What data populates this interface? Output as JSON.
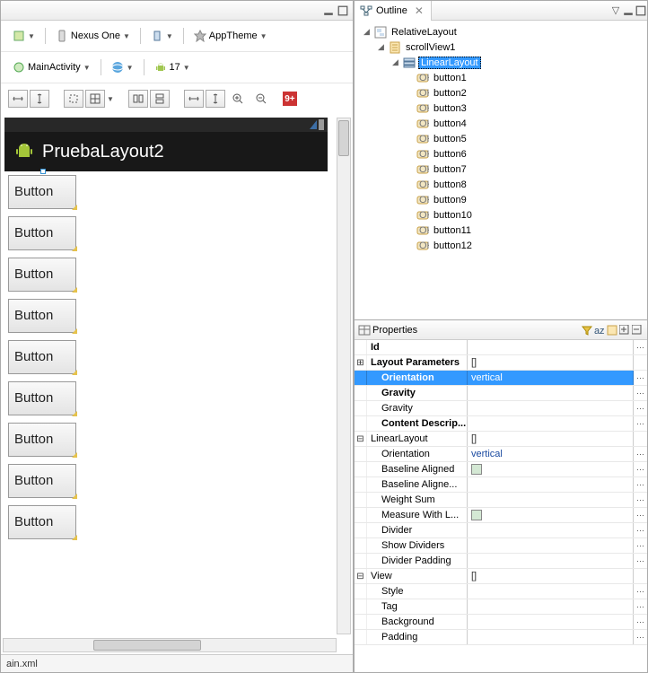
{
  "toolbar": {
    "device": "Nexus One",
    "theme": "AppTheme",
    "activity": "MainActivity",
    "api": "17"
  },
  "preview": {
    "title": "PruebaLayout2",
    "button_label": "Button",
    "button_count": 9
  },
  "editor_tab": "ain.xml",
  "outline": {
    "tab": "Outline",
    "root": "RelativeLayout",
    "scroll": "scrollView1",
    "linear": "LinearLayout",
    "buttons": [
      "button1",
      "button2",
      "button3",
      "button4",
      "button5",
      "button6",
      "button7",
      "button8",
      "button9",
      "button10",
      "button11",
      "button12"
    ]
  },
  "properties": {
    "title": "Properties",
    "rows": {
      "id": "Id",
      "layout_params": "Layout Parameters",
      "layout_params_val": "[]",
      "orientation": "Orientation",
      "orientation_val": "vertical",
      "gravity_b": "Gravity",
      "gravity": "Gravity",
      "content_desc": "Content Descrip...",
      "linear": "LinearLayout",
      "linear_val": "[]",
      "orientation2": "Orientation",
      "orientation2_val": "vertical",
      "baseline": "Baseline Aligned",
      "baseline_idx": "Baseline Aligne...",
      "weight": "Weight Sum",
      "measure": "Measure With L...",
      "divider": "Divider",
      "show_div": "Show Dividers",
      "div_pad": "Divider Padding",
      "view": "View",
      "view_val": "[]",
      "style": "Style",
      "tag": "Tag",
      "background": "Background",
      "padding": "Padding"
    }
  }
}
